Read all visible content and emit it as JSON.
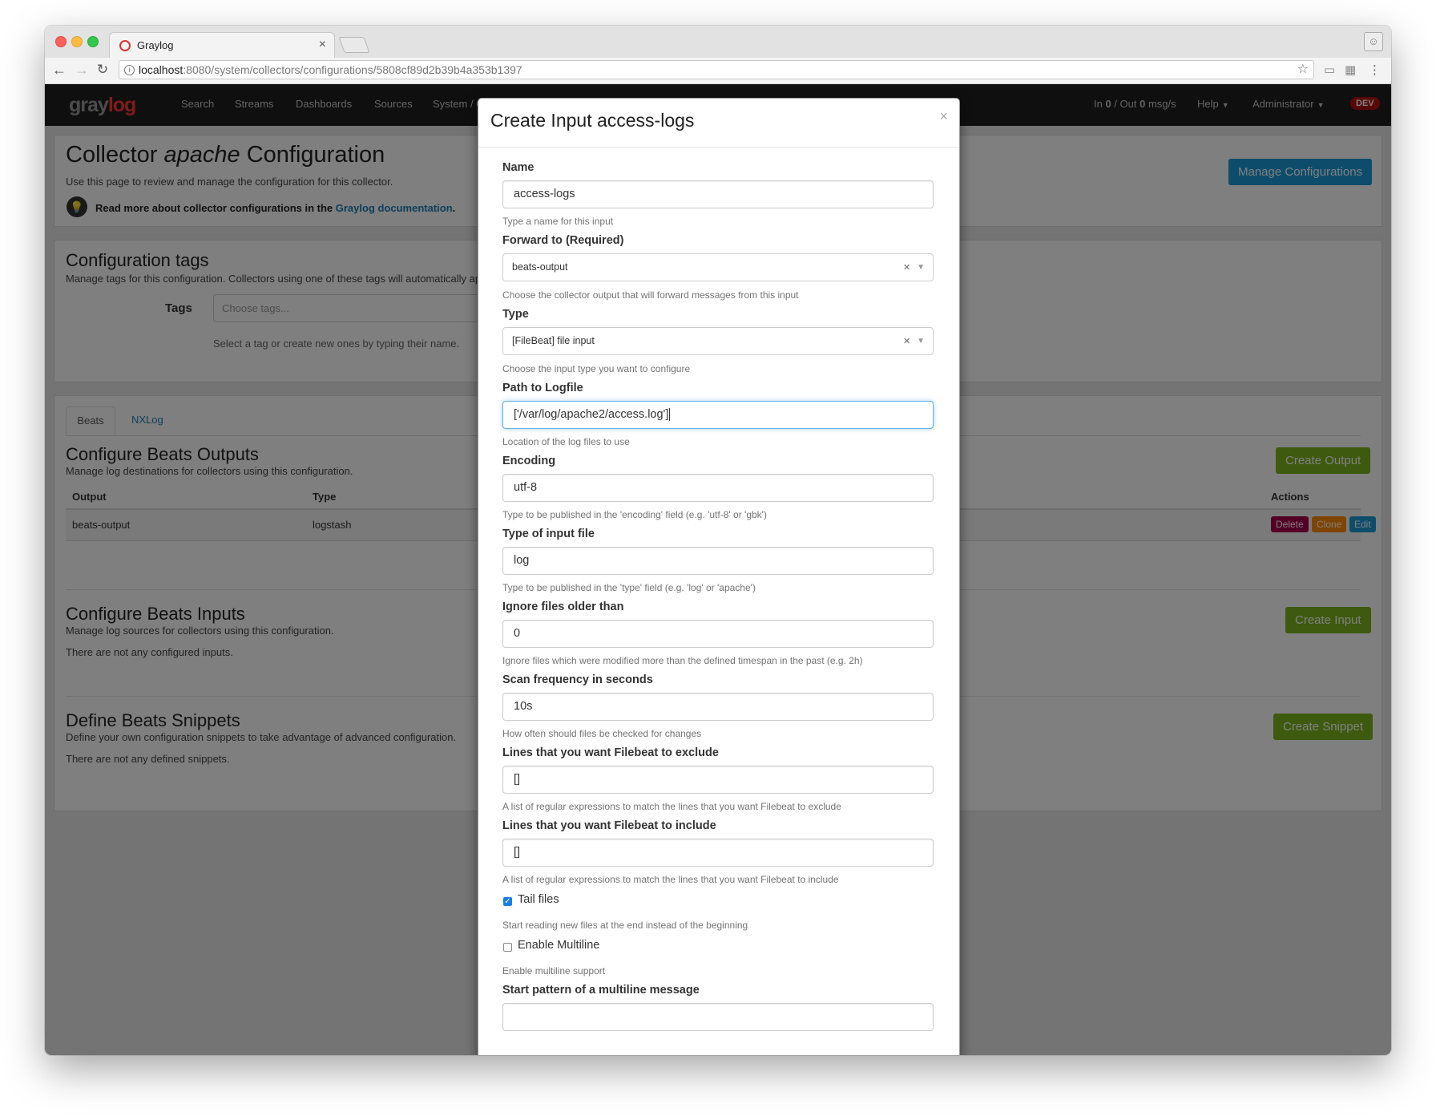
{
  "browser": {
    "tab_title": "Graylog",
    "url_host": "localhost",
    "url_rest": ":8080/system/collectors/configurations/5808cf89d2b39b4a353b1397"
  },
  "nav": {
    "logo_gray": "gray",
    "logo_log": "log",
    "items": [
      "Search",
      "Streams",
      "Dashboards",
      "Sources",
      "System / Collectors"
    ],
    "throughput": {
      "in_label": "In ",
      "in_value": "0",
      "sep": " / Out ",
      "out_value": "0",
      "unit": " msg/s"
    },
    "help": "Help",
    "user": "Administrator",
    "badge": "DEV"
  },
  "page": {
    "title_pre": "Collector ",
    "title_em": "apache",
    "title_post": " Configuration",
    "subtitle": "Use this page to review and manage the configuration for this collector.",
    "docs_text": "Read more about collector configurations in the ",
    "docs_link": "Graylog documentation",
    "docs_end": ".",
    "manage_button": "Manage Configurations"
  },
  "tags": {
    "title": "Configuration tags",
    "description": "Manage tags for this configuration. Collectors using one of these tags will automatically apply",
    "label": "Tags",
    "placeholder": "Choose tags...",
    "help": "Select a tag or create new ones by typing their name."
  },
  "beats": {
    "tabs": [
      "Beats",
      "NXLog"
    ],
    "outputs_title": "Configure Beats Outputs",
    "outputs_desc": "Manage log destinations for collectors using this configuration.",
    "create_output": "Create Output",
    "columns": [
      "Output",
      "Type",
      "Actions"
    ],
    "rows": [
      {
        "output": "beats-output",
        "type": "logstash"
      }
    ],
    "row_actions": [
      "Delete",
      "Clone",
      "Edit"
    ],
    "inputs_title": "Configure Beats Inputs",
    "inputs_desc": "Manage log sources for collectors using this configuration.",
    "inputs_empty": "There are not any configured inputs.",
    "create_input": "Create Input",
    "snippets_title": "Define Beats Snippets",
    "snippets_desc": "Define your own configuration snippets to take advantage of advanced configuration.",
    "snippets_empty": "There are not any defined snippets.",
    "create_snippet": "Create Snippet"
  },
  "modal": {
    "title": "Create Input access-logs",
    "close": "×",
    "fields": [
      {
        "label": "Name",
        "value": "access-logs",
        "help": "Type a name for this input"
      },
      {
        "label": "Forward to (Required)",
        "value": "beats-output",
        "help": "Choose the collector output that will forward messages from this input"
      },
      {
        "label": "Type",
        "value": "[FileBeat] file input",
        "help": "Choose the input type you want to configure"
      },
      {
        "label": "Path to Logfile",
        "value": "['/var/log/apache2/access.log']",
        "help": "Location of the log files to use"
      },
      {
        "label": "Encoding",
        "value": "utf-8",
        "help": "Type to be published in the 'encoding' field (e.g. 'utf-8' or 'gbk')"
      },
      {
        "label": "Type of input file",
        "value": "log",
        "help": "Type to be published in the 'type' field (e.g. 'log' or 'apache')"
      },
      {
        "label": "Ignore files older than",
        "value": "0",
        "help": "Ignore files which were modified more than the defined timespan in the past (e.g. 2h)"
      },
      {
        "label": "Scan frequency in seconds",
        "value": "10s",
        "help": "How often should files be checked for changes"
      },
      {
        "label": "Lines that you want Filebeat to exclude",
        "value": "[]",
        "help": "A list of regular expressions to match the lines that you want Filebeat to exclude"
      },
      {
        "label": "Lines that you want Filebeat to include",
        "value": "[]",
        "help": "A list of regular expressions to match the lines that you want Filebeat to include"
      }
    ],
    "tail_files": {
      "label": "Tail files",
      "checked": true,
      "help": "Start reading new files at the end instead of the beginning"
    },
    "multiline": {
      "label": "Enable Multiline",
      "checked": false,
      "help": "Enable multiline support"
    },
    "multiline_pattern": {
      "label": "Start pattern of a multiline message",
      "value": ""
    }
  }
}
